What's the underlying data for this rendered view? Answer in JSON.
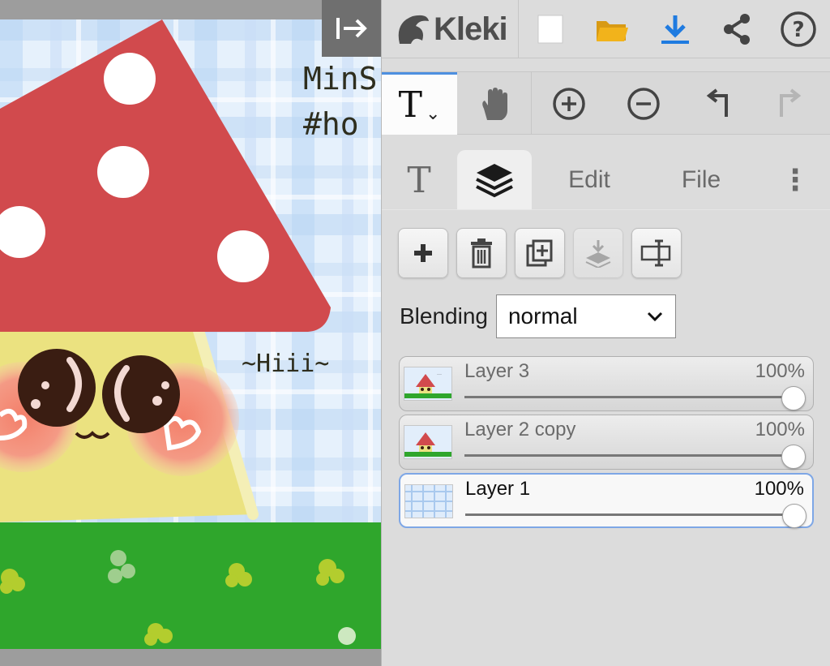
{
  "canvas": {
    "text_line1": "MinS",
    "text_line2": "#ho",
    "greeting": "~Hiii~",
    "colors": {
      "cap": "#d14a4d",
      "body": "#ebe280",
      "cheek": "#f08b78",
      "grass": "#2fa62c",
      "sky": "#dfeefb"
    }
  },
  "topbar": {
    "logo_text": "Kleki",
    "icons": [
      "new-image-icon",
      "open-folder-icon",
      "download-icon",
      "share-icon",
      "help-icon"
    ]
  },
  "toolrow": {
    "active_tool_glyph": "T",
    "active_tool_caret": "⌄",
    "icons": [
      "text-tool-icon",
      "hand-tool-icon",
      "zoom-in-icon",
      "zoom-out-icon",
      "undo-icon",
      "redo-icon"
    ]
  },
  "tabs": {
    "text_tab_glyph": "T",
    "edit": "Edit",
    "file": "File",
    "more_glyph": "⋮",
    "active": "layers"
  },
  "layers_panel": {
    "blending_label": "Blending",
    "blending_value": "normal",
    "action_icons": [
      "add-layer-icon",
      "delete-layer-icon",
      "duplicate-layer-icon",
      "merge-down-icon",
      "rename-layer-icon"
    ],
    "layers": [
      {
        "name": "Layer 3",
        "opacity_label": "100%",
        "opacity": 1.0,
        "selected": false
      },
      {
        "name": "Layer 2 copy",
        "opacity_label": "100%",
        "opacity": 1.0,
        "selected": false
      },
      {
        "name": "Layer 1",
        "opacity_label": "100%",
        "opacity": 1.0,
        "selected": true
      }
    ]
  },
  "accent_color": "#4d8fe0",
  "download_color": "#1f7be0",
  "folder_color": "#f2b31b"
}
